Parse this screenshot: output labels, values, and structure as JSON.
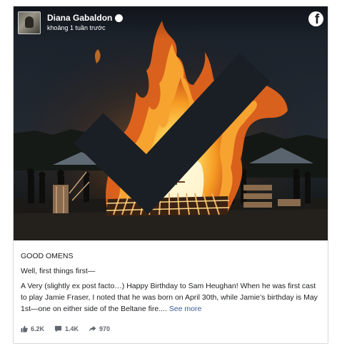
{
  "post": {
    "author_name": "Diana Gabaldon",
    "time": "khoảng 1 tuần trước",
    "heading": "GOOD OMENS",
    "intro": "Well, first things first—",
    "body": "A Very (slightly ex post facto…) Happy Birthday to Sam Heughan! When he was first cast to play Jamie Fraser, I noted that he was born on April 30th, while Jamie’s birthday is May 1st—one on either side of the Beltane fire....",
    "see_more": "See more"
  },
  "stats": {
    "likes": "6.2K",
    "comments": "1.4K",
    "shares": "970"
  },
  "icons": {
    "verified": "verified-check-icon",
    "brand": "facebook-icon",
    "likes": "thumbs-up-icon",
    "comments": "comment-icon",
    "shares": "share-icon"
  },
  "colors": {
    "link": "#385898",
    "meta": "#606770",
    "text": "#1c1e21"
  }
}
